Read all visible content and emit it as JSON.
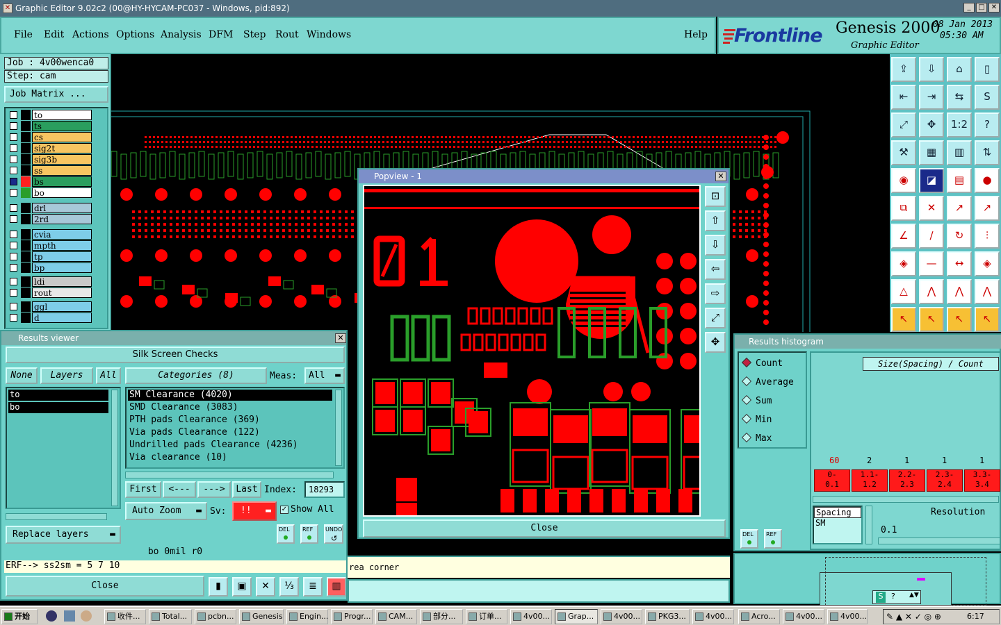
{
  "titlebar": {
    "title": "Graphic Editor 9.02c2 (00@HY-HYCAM-PC037 - Windows, pid:892)"
  },
  "menu": [
    "File",
    "Edit",
    "Actions",
    "Options",
    "Analysis",
    "DFM",
    "Step",
    "Rout",
    "Windows"
  ],
  "help": "Help",
  "logo": {
    "brand": "Frontline",
    "product": "Genesis 2000",
    "subtitle": "Graphic Editor",
    "date": "08 Jan 2013",
    "time": "05:30 AM"
  },
  "job": {
    "job_label": "Job : 4v00wenca0",
    "step_label": "Step: cam",
    "matrix_button": "Job Matrix ..."
  },
  "layers": [
    {
      "name": "to",
      "color": "#ffffff"
    },
    {
      "name": "ts",
      "color": "#2a9e5e"
    },
    {
      "name": "cs",
      "color": "#f7c561"
    },
    {
      "name": "sig2t",
      "color": "#f7c561"
    },
    {
      "name": "sig3b",
      "color": "#f7c561"
    },
    {
      "name": "ss",
      "color": "#f7c561"
    },
    {
      "name": "bs",
      "color": "#2a9e5e"
    },
    {
      "name": "bo",
      "color": "#ffffff"
    },
    {
      "name": "drl",
      "color": "#a8c8d8"
    },
    {
      "name": "2rd",
      "color": "#a8c8d8"
    },
    {
      "name": "cvia",
      "color": "#7ecde8"
    },
    {
      "name": "mpth",
      "color": "#7ecde8"
    },
    {
      "name": "tp",
      "color": "#7ecde8"
    },
    {
      "name": "bp",
      "color": "#7ecde8"
    },
    {
      "name": "ldi",
      "color": "#c8c8c8"
    },
    {
      "name": "rout",
      "color": "#e8e8e8"
    },
    {
      "name": "ggl",
      "color": "#7ecde8"
    },
    {
      "name": "d",
      "color": "#7ecde8"
    }
  ],
  "results_viewer": {
    "title": "Results viewer",
    "header": "Silk Screen Checks",
    "none_btn": "None",
    "layers_btn": "Layers",
    "all_btn": "All",
    "categories_btn": "Categories (8)",
    "meas_label": "Meas:",
    "meas_value": "All",
    "layer_items": [
      "to",
      "bo"
    ],
    "categories": [
      "SM Clearance (4020)",
      "SMD Clearance (3083)",
      "PTH pads Clearance (369)",
      "Via pads Clearance (122)",
      "Undrilled pads Clearance (4236)",
      "Via clearance (10)"
    ],
    "first": "First",
    "prev": "<---",
    "next": "--->",
    "last": "Last",
    "index_label": "Index:",
    "index_value": "18293",
    "auto_zoom": "Auto Zoom",
    "sv_label": "Sv:",
    "sv_value": "!!",
    "show_all": "Show All",
    "replace_layers": "Replace layers",
    "del": "DEL",
    "ref": "REF",
    "undo": "UNDO",
    "status": "bo  0mil   r0",
    "erf": "ERF--> ss2sm = 5 7 10",
    "close": "Close"
  },
  "popview": {
    "title": "Popview - 1",
    "close": "Close"
  },
  "histogram": {
    "title": "Results histogram",
    "options": [
      "Count",
      "Average",
      "Sum",
      "Min",
      "Max"
    ],
    "selected": "Count",
    "header": "Size(Spacing) / Count",
    "counts": [
      "60",
      "2",
      "1",
      "1",
      "1"
    ],
    "bins": [
      "0-\n0.1",
      "1.1-\n1.2",
      "2.2-\n2.3",
      "2.3-\n2.4",
      "3.3-\n3.4"
    ],
    "spacing_title": "Spacing",
    "spacing_item": "SM",
    "resolution_label": "Resolution",
    "resolution_value": "0.1",
    "del": "DEL",
    "ref": "REF"
  },
  "message": "rea corner",
  "taskbar": {
    "start": "开始",
    "items": [
      "收件...",
      "Total...",
      "pcbn...",
      "Genesis",
      "Engin...",
      "Progr...",
      "CAM...",
      "部分...",
      "订单...",
      "4v00...",
      "Grap...",
      "4v00...",
      "PKG3...",
      "4v00...",
      "Acro...",
      "4v00...",
      "4v00..."
    ],
    "clock": "6:17"
  },
  "colors": {
    "panel": "#7ed7d0",
    "copper": "#ff0000",
    "silk": "#2a9e2a"
  }
}
